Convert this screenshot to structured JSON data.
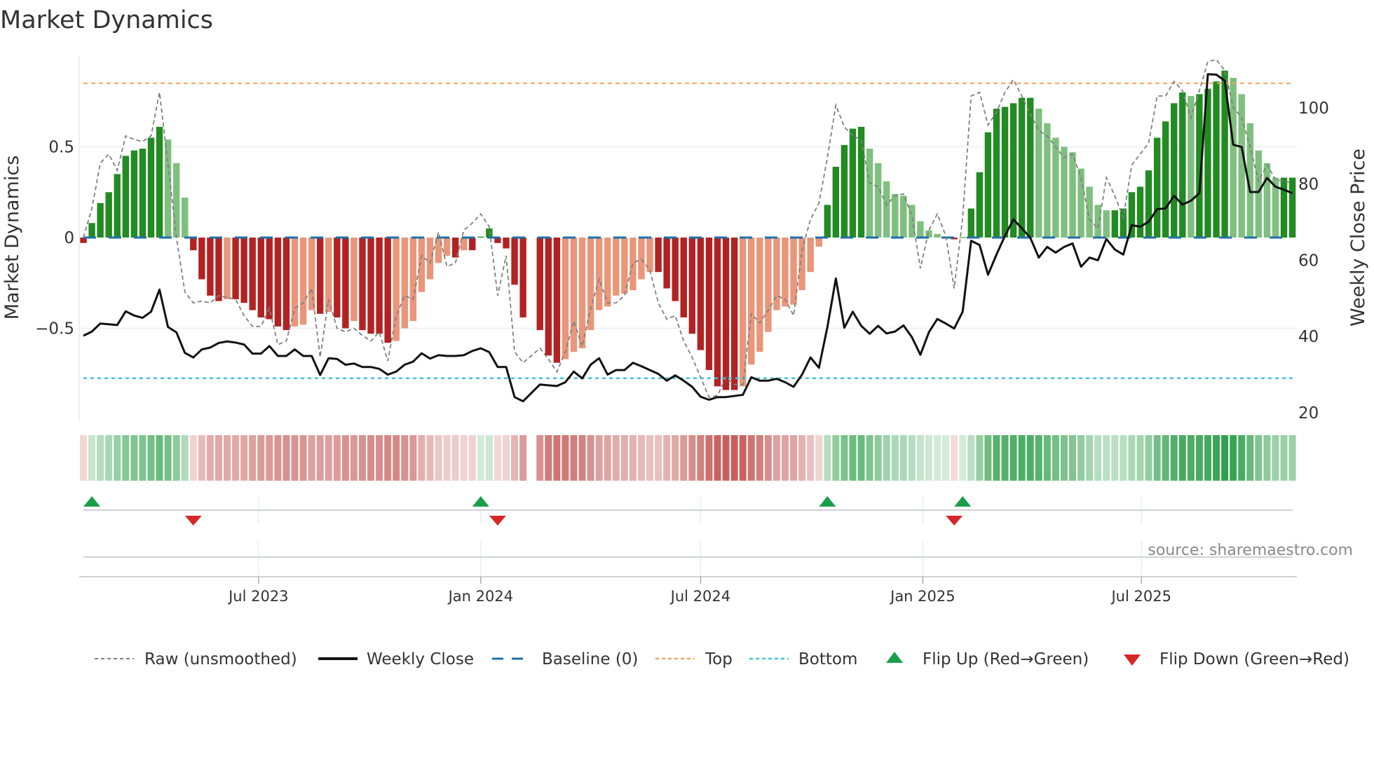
{
  "title": "Market Dynamics",
  "source": "source: sharemaestro.com",
  "colors": {
    "pos_strong": "#228b22",
    "pos_weak": "#7fbf7f",
    "neg_strong": "#b22222",
    "neg_weak": "#e9967a",
    "raw": "#808080",
    "close": "#111111",
    "baseline": "#1f6fa8",
    "top": "#f4a460",
    "bottom": "#3ec5d8",
    "flip_up": "#1a9e4a",
    "flip_down": "#d62728",
    "heat_pos": "#2e9e4a",
    "heat_neg": "#c0504d"
  },
  "chart_data": {
    "type": "bar",
    "title": "Market Dynamics",
    "ylabel": "Market Dynamics",
    "ylabel_right": "Weekly Close Price",
    "ylim": [
      -1.0,
      1.0
    ],
    "ylim_right": [
      18,
      113.4
    ],
    "yticks": [
      {
        "value": 0.5,
        "label": "0.5"
      },
      {
        "value": 0,
        "label": "0"
      },
      {
        "value": -0.5,
        "label": "−0.5"
      }
    ],
    "yticks_right": [
      {
        "value": 20,
        "label": "20"
      },
      {
        "value": 40,
        "label": "40"
      },
      {
        "value": 60,
        "label": "60"
      },
      {
        "value": 80,
        "label": "80"
      },
      {
        "value": 100,
        "label": "100"
      }
    ],
    "xticks": [
      {
        "date": "2023-07-01",
        "label": "Jul 2023"
      },
      {
        "date": "2024-01-01",
        "label": "Jan 2024"
      },
      {
        "date": "2024-07-01",
        "label": "Jul 2024"
      },
      {
        "date": "2025-01-01",
        "label": "Jan 2025"
      },
      {
        "date": "2025-07-01",
        "label": "Jul 2025"
      }
    ],
    "start_date": "2023-02-06",
    "frequency": "weekly",
    "top_level": 0.85,
    "bottom_level": -0.775,
    "baseline": 0,
    "grid": true,
    "legend_position": "bottom",
    "series": [
      {
        "name": "Market Dynamics",
        "type": "bar",
        "values": [
          -0.03,
          0.08,
          0.19,
          0.25,
          0.35,
          0.45,
          0.48,
          0.49,
          0.55,
          0.61,
          0.54,
          0.41,
          0.22,
          -0.07,
          -0.23,
          -0.32,
          -0.35,
          -0.34,
          -0.34,
          -0.36,
          -0.4,
          -0.44,
          -0.45,
          -0.49,
          -0.51,
          -0.49,
          -0.48,
          -0.4,
          -0.42,
          -0.41,
          -0.44,
          -0.5,
          -0.46,
          -0.51,
          -0.53,
          -0.53,
          -0.58,
          -0.57,
          -0.5,
          -0.46,
          -0.3,
          -0.23,
          -0.14,
          -0.1,
          -0.11,
          -0.07,
          -0.07,
          0.005,
          0.05,
          -0.03,
          -0.06,
          -0.26,
          -0.44,
          null,
          -0.51,
          -0.65,
          -0.69,
          -0.67,
          -0.63,
          -0.61,
          -0.51,
          -0.4,
          -0.38,
          -0.32,
          -0.31,
          -0.29,
          -0.23,
          -0.19,
          -0.19,
          -0.28,
          -0.35,
          -0.44,
          -0.53,
          -0.62,
          -0.73,
          -0.82,
          -0.84,
          -0.84,
          -0.82,
          -0.7,
          -0.63,
          -0.52,
          -0.4,
          -0.38,
          -0.37,
          -0.29,
          -0.19,
          -0.05,
          0.18,
          0.39,
          0.51,
          0.6,
          0.61,
          0.49,
          0.41,
          0.31,
          0.24,
          0.23,
          0.18,
          0.09,
          0.04,
          0.02,
          0.005,
          -0.01,
          0.002,
          0.16,
          0.36,
          0.58,
          0.71,
          0.72,
          0.74,
          0.77,
          0.77,
          0.71,
          0.63,
          0.55,
          0.5,
          0.47,
          0.38,
          0.28,
          0.18,
          0.15,
          0.15,
          0.16,
          0.25,
          0.28,
          0.37,
          0.55,
          0.64,
          0.74,
          0.8,
          0.78,
          0.79,
          0.82,
          0.86,
          0.92,
          0.88,
          0.79,
          0.63,
          0.48,
          0.41,
          0.33,
          0.33,
          0.33
        ]
      },
      {
        "name": "Raw (unsmoothed)",
        "type": "line",
        "values": [
          0.0,
          0.16,
          0.41,
          0.46,
          0.37,
          0.56,
          0.54,
          0.53,
          0.56,
          0.8,
          0.41,
          0.0,
          -0.3,
          -0.36,
          -0.35,
          -0.36,
          -0.32,
          -0.33,
          -0.34,
          -0.43,
          -0.49,
          -0.49,
          -0.39,
          -0.59,
          -0.57,
          -0.39,
          -0.36,
          -0.28,
          -0.66,
          -0.34,
          -0.5,
          -0.52,
          -0.5,
          -0.54,
          -0.57,
          -0.52,
          -0.68,
          -0.43,
          -0.32,
          -0.34,
          -0.1,
          -0.14,
          0.03,
          -0.16,
          -0.14,
          0.04,
          0.08,
          0.13,
          0.06,
          -0.32,
          -0.1,
          -0.63,
          -0.69,
          -0.65,
          -0.61,
          -0.67,
          -0.74,
          -0.63,
          -0.46,
          -0.6,
          -0.39,
          -0.23,
          -0.36,
          -0.36,
          -0.32,
          -0.14,
          -0.12,
          -0.18,
          -0.36,
          -0.45,
          -0.43,
          -0.57,
          -0.66,
          -0.77,
          -0.88,
          -0.87,
          -0.77,
          -0.81,
          -0.81,
          -0.42,
          -0.47,
          -0.4,
          -0.32,
          -0.34,
          -0.43,
          -0.07,
          0.1,
          0.19,
          0.44,
          0.73,
          0.61,
          0.56,
          0.54,
          0.3,
          0.28,
          0.18,
          0.23,
          0.24,
          0.12,
          -0.17,
          0.04,
          0.13,
          0.01,
          -0.28,
          0.11,
          0.78,
          0.8,
          0.62,
          0.69,
          0.8,
          0.87,
          0.78,
          0.68,
          0.59,
          0.56,
          0.5,
          0.44,
          0.46,
          0.33,
          0.1,
          0.05,
          0.33,
          0.23,
          0.11,
          0.4,
          0.46,
          0.52,
          0.78,
          0.78,
          0.86,
          0.81,
          0.66,
          0.81,
          0.97,
          0.98,
          0.92,
          0.72,
          0.66,
          0.5,
          0.31,
          0.4,
          0.32,
          0.31,
          0.3
        ]
      },
      {
        "name": "Weekly Close",
        "type": "line",
        "axis": "right",
        "values": [
          40.2,
          41.3,
          43.4,
          43.2,
          43.0,
          46.6,
          45.5,
          44.9,
          46.5,
          52.3,
          42.5,
          41.1,
          35.7,
          34.5,
          36.6,
          37.1,
          38.3,
          38.7,
          38.4,
          37.9,
          35.5,
          35.5,
          37.5,
          34.9,
          34.9,
          36.6,
          34.9,
          34.9,
          29.9,
          34.3,
          34.1,
          32.6,
          32.9,
          32.0,
          32.0,
          31.5,
          30.0,
          30.8,
          32.6,
          33.4,
          35.6,
          34.2,
          35.1,
          34.9,
          34.9,
          35.1,
          36.2,
          36.9,
          35.9,
          32.0,
          32.0,
          24.1,
          23.0,
          25.2,
          27.4,
          27.2,
          27.0,
          28.0,
          30.8,
          29.0,
          32.6,
          34.3,
          30.0,
          31.2,
          31.2,
          33.1,
          32.2,
          31.2,
          30.2,
          28.4,
          29.8,
          28.4,
          26.8,
          24.2,
          23.4,
          24.1,
          24.1,
          24.4,
          24.7,
          29.3,
          28.4,
          28.4,
          28.9,
          28.0,
          26.8,
          30.0,
          34.5,
          31.8,
          42.5,
          55.2,
          42.3,
          46.5,
          42.8,
          40.7,
          42.8,
          40.8,
          41.3,
          42.9,
          39.8,
          35.2,
          41.1,
          44.6,
          43.4,
          42.1,
          46.5,
          65.1,
          64.0,
          56.2,
          61.5,
          66.4,
          70.7,
          68.4,
          65.9,
          60.7,
          63.5,
          62.0,
          63.5,
          64.4,
          58.3,
          60.7,
          60.0,
          65.6,
          62.8,
          61.5,
          69.2,
          68.8,
          70.1,
          73.4,
          73.6,
          76.9,
          74.6,
          75.6,
          77.6,
          108.8,
          108.7,
          107.1,
          90.3,
          89.7,
          77.9,
          77.9,
          81.6,
          79.3,
          78.5,
          77.6
        ]
      }
    ],
    "flip_up": [
      "2023-02-13",
      "2024-01-01",
      "2024-10-14",
      "2025-02-03"
    ],
    "flip_down": [
      "2023-05-08",
      "2024-01-15",
      "2025-01-27"
    ]
  },
  "legend": {
    "items": [
      {
        "label": "Raw (unsmoothed)"
      },
      {
        "label": "Weekly Close"
      },
      {
        "label": "Baseline (0)"
      },
      {
        "label": "Top"
      },
      {
        "label": "Bottom"
      },
      {
        "label": "Flip Up (Red→Green)"
      },
      {
        "label": "Flip Down (Green→Red)"
      }
    ]
  }
}
